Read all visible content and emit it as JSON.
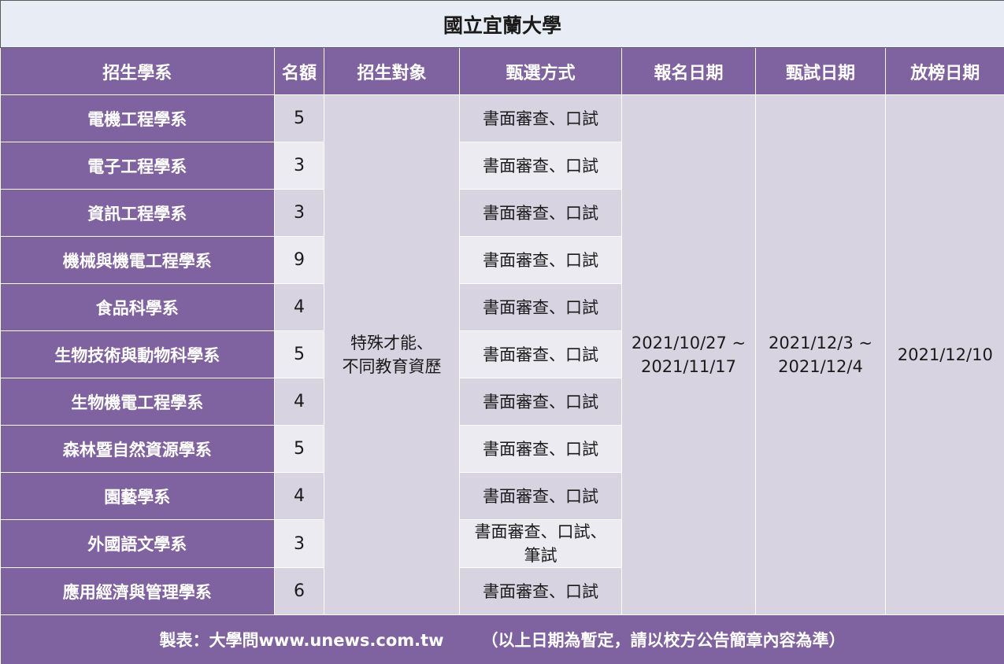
{
  "title": "國立宜蘭大學",
  "headers": {
    "department": "招生學系",
    "quota": "名額",
    "target": "招生對象",
    "method": "甄選方式",
    "apply_date": "報名日期",
    "exam_date": "甄試日期",
    "result_date": "放榜日期"
  },
  "rows": [
    {
      "department": "電機工程學系",
      "quota": "5",
      "method_line1": "書面審查、口試",
      "method_line2": ""
    },
    {
      "department": "電子工程學系",
      "quota": "3",
      "method_line1": "書面審查、口試",
      "method_line2": ""
    },
    {
      "department": "資訊工程學系",
      "quota": "3",
      "method_line1": "書面審查、口試",
      "method_line2": ""
    },
    {
      "department": "機械與機電工程學系",
      "quota": "9",
      "method_line1": "書面審查、口試",
      "method_line2": ""
    },
    {
      "department": "食品科學系",
      "quota": "4",
      "method_line1": "書面審查、口試",
      "method_line2": ""
    },
    {
      "department": "生物技術與動物科學系",
      "quota": "5",
      "method_line1": "書面審查、口試",
      "method_line2": ""
    },
    {
      "department": "生物機電工程學系",
      "quota": "4",
      "method_line1": "書面審查、口試",
      "method_line2": ""
    },
    {
      "department": "森林暨自然資源學系",
      "quota": "5",
      "method_line1": "書面審查、口試",
      "method_line2": ""
    },
    {
      "department": "園藝學系",
      "quota": "4",
      "method_line1": "書面審查、口試",
      "method_line2": ""
    },
    {
      "department": "外國語文學系",
      "quota": "3",
      "method_line1": "書面審查、口試、",
      "method_line2": "筆試"
    },
    {
      "department": "應用經濟與管理學系",
      "quota": "6",
      "method_line1": "書面審查、口試",
      "method_line2": ""
    }
  ],
  "merged": {
    "target_line1": "特殊才能、",
    "target_line2": "不同教育資歷",
    "apply_line1": "2021/10/27 ~",
    "apply_line2": "2021/11/17",
    "exam_line1": "2021/12/3 ~",
    "exam_line2": "2021/12/4",
    "result": "2021/12/10"
  },
  "footer": {
    "credit": "製表：大學問www.unews.com.tw",
    "note": "（以上日期為暫定，請以校方公告簡章內容為準）"
  },
  "colors": {
    "header_purple": "#7f63a1",
    "cell_lavender": "#d7d3e1",
    "cell_light": "#ecebf1",
    "title_bg": "#e8ecf5"
  }
}
